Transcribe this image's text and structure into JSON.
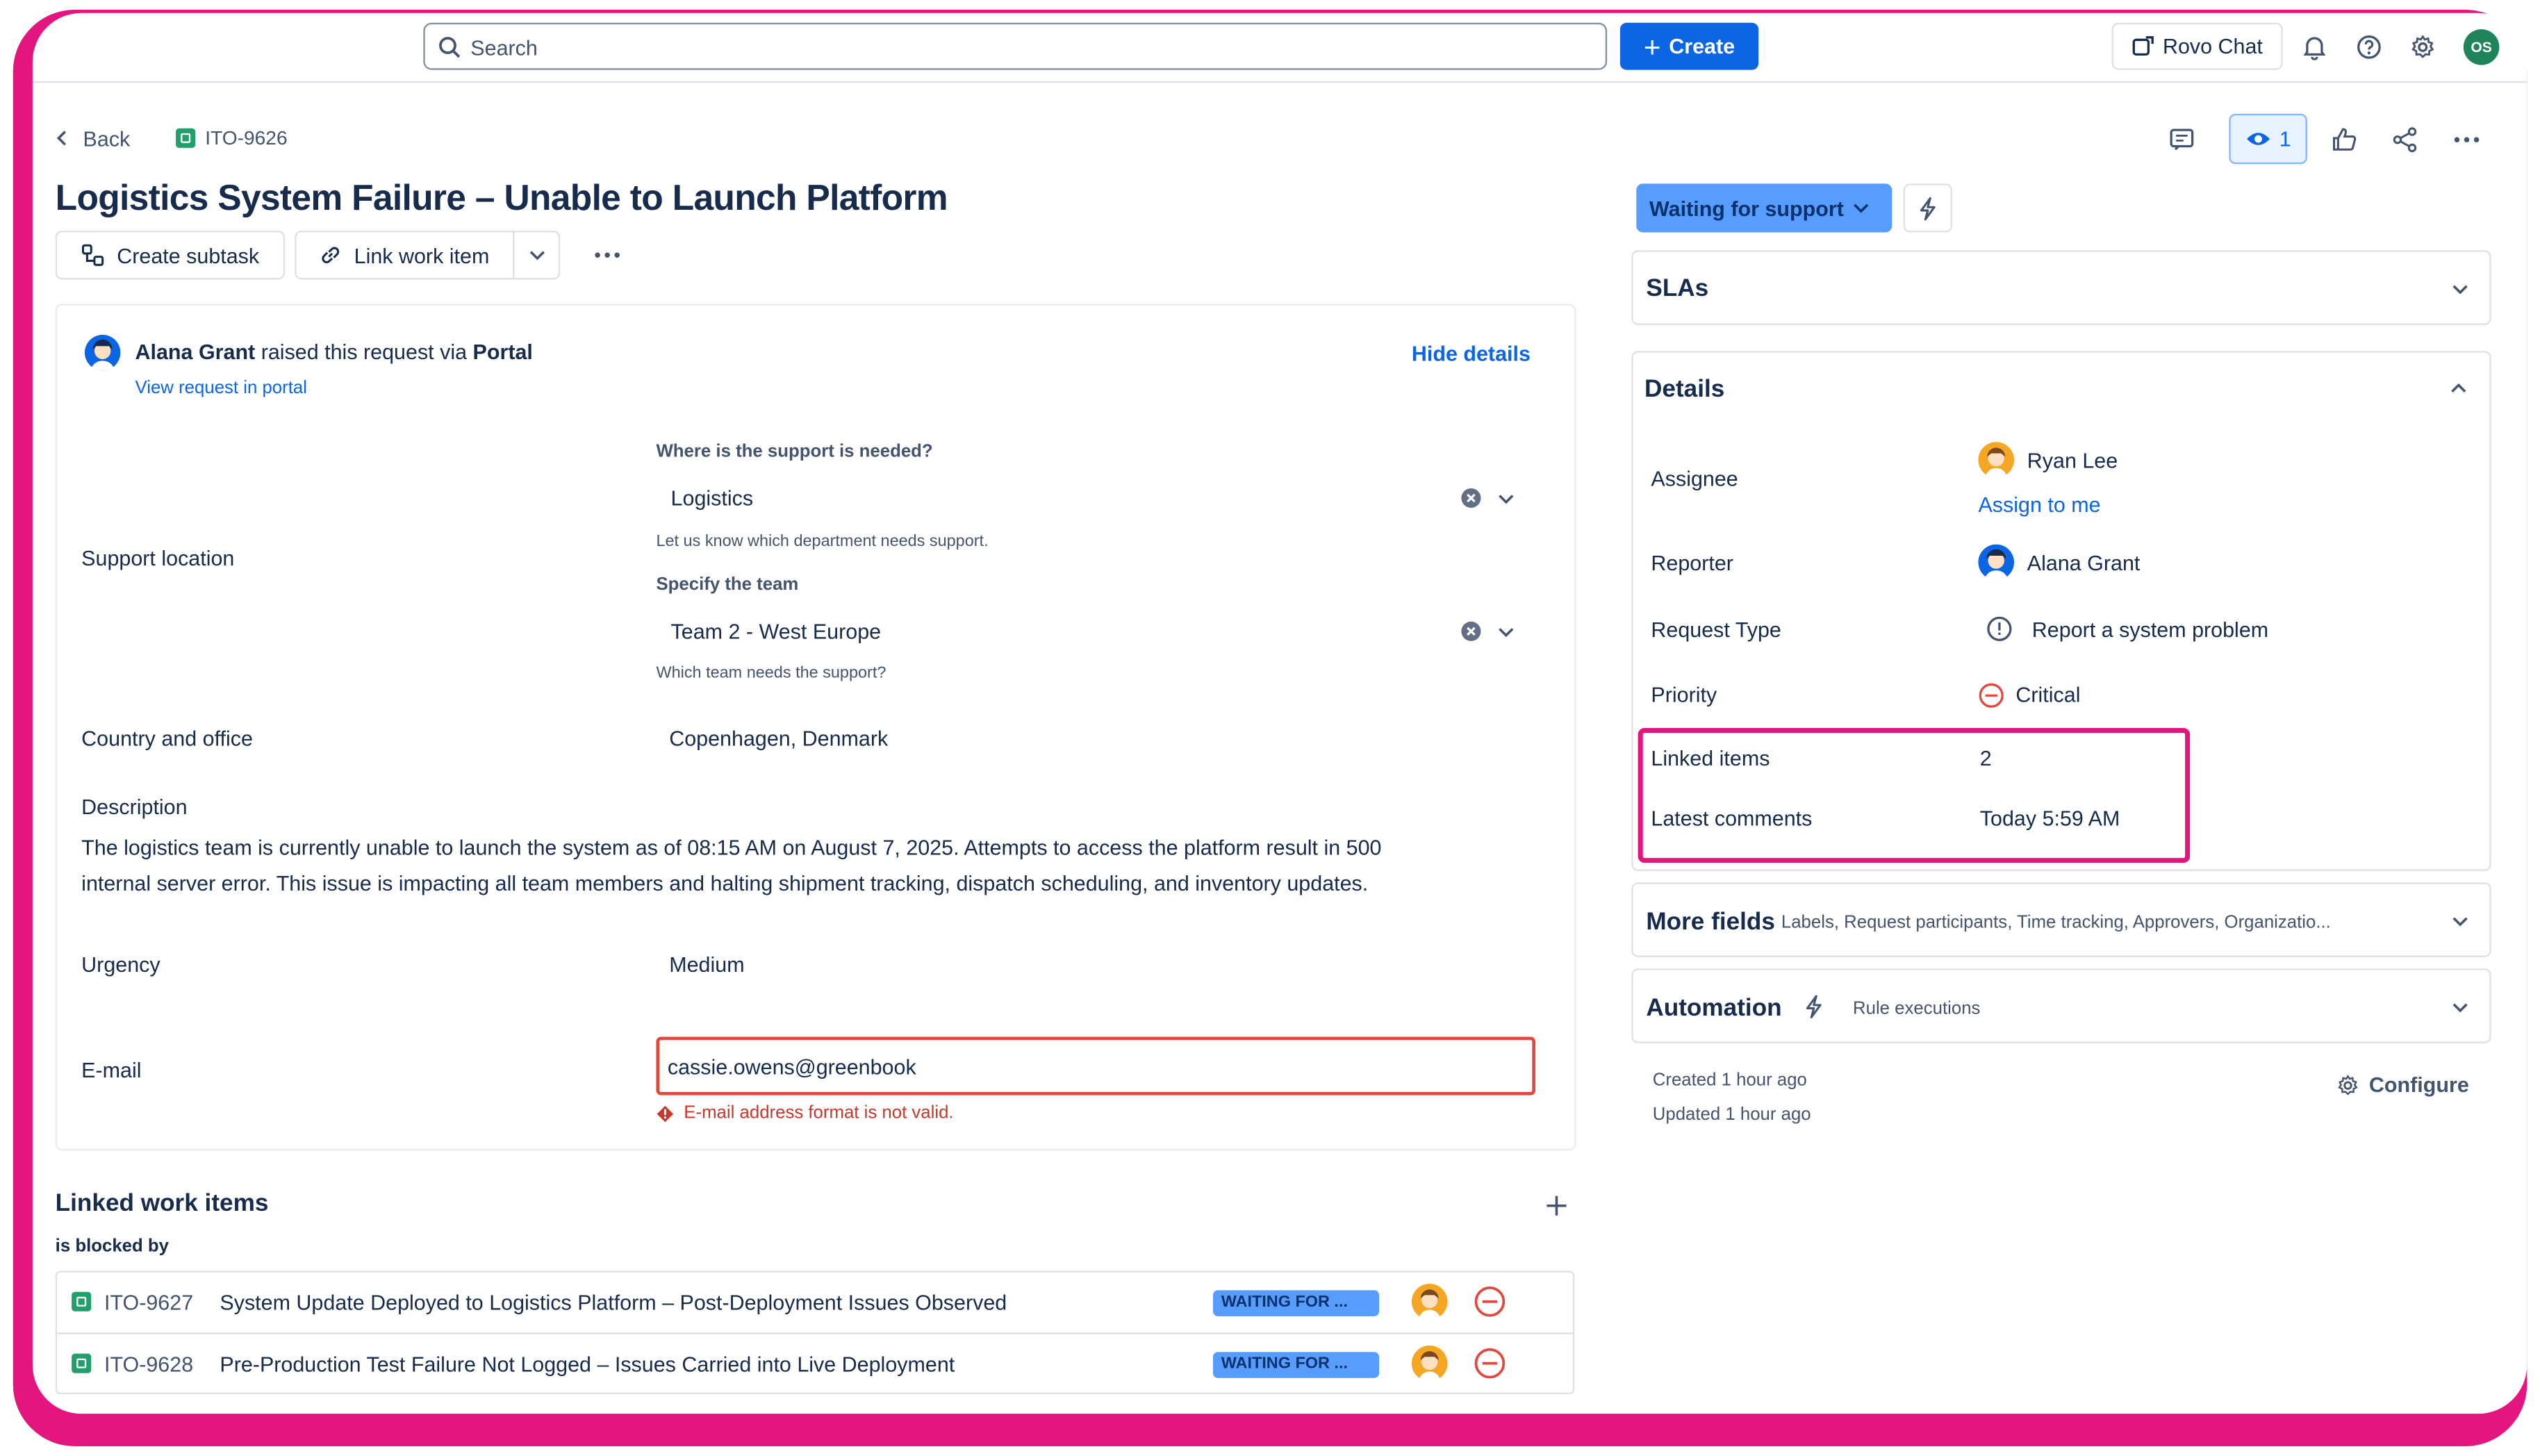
{
  "topbar": {
    "search_placeholder": "Search",
    "create_label": "Create",
    "rovo_label": "Rovo Chat",
    "avatar_initials": "OS"
  },
  "breadcrumb": {
    "back_label": "Back",
    "issue_key": "ITO-9626"
  },
  "issue": {
    "title": "Logistics System Failure – Unable to Launch Platform",
    "create_subtask": "Create subtask",
    "link_work_item": "Link work item",
    "watch_count": "1"
  },
  "request": {
    "reporter_name": "Alana Grant",
    "raised_text": "raised this request via",
    "channel": "Portal",
    "view_portal": "View request in portal",
    "hide_details": "Hide details",
    "support_location_label": "Support location",
    "where_needed_label": "Where is the support is needed?",
    "where_needed_value": "Logistics",
    "where_needed_help": "Let us know which department needs support.",
    "team_label": "Specify the team",
    "team_value": "Team 2 - West Europe",
    "team_help": "Which team needs the support?",
    "country_label": "Country and office",
    "country_value": "Copenhagen, Denmark",
    "description_label": "Description",
    "description_line1": "The logistics team is currently unable to launch the system as of 08:15 AM on August 7, 2025. Attempts to access the platform result in 500",
    "description_line2": "internal server error. This issue is impacting all team members and halting shipment tracking, dispatch scheduling, and inventory updates.",
    "urgency_label": "Urgency",
    "urgency_value": "Medium",
    "email_label": "E-mail",
    "email_value": "cassie.owens@greenbook",
    "email_error": "E-mail address format is not valid."
  },
  "linked": {
    "heading": "Linked work items",
    "relation": "is blocked by",
    "items": [
      {
        "key": "ITO-9627",
        "summary": "System Update Deployed to Logistics Platform – Post-Deployment Issues Observed",
        "status": "WAITING FOR ..."
      },
      {
        "key": "ITO-9628",
        "summary": "Pre-Production Test Failure Not Logged – Issues Carried into Live Deployment",
        "status": "WAITING FOR ..."
      }
    ]
  },
  "sidebar": {
    "status_label": "Waiting for support",
    "slas_label": "SLAs",
    "details_label": "Details",
    "assignee_label": "Assignee",
    "assignee_name": "Ryan Lee",
    "assign_to_me": "Assign to me",
    "reporter_label": "Reporter",
    "reporter_name": "Alana Grant",
    "request_type_label": "Request Type",
    "request_type_value": "Report a system problem",
    "priority_label": "Priority",
    "priority_value": "Critical",
    "linked_items_label": "Linked items",
    "linked_items_value": "2",
    "latest_comments_label": "Latest comments",
    "latest_comments_value": "Today 5:59 AM",
    "more_fields_label": "More fields",
    "more_fields_summary": "Labels, Request participants, Time tracking, Approvers, Organizatio...",
    "automation_label": "Automation",
    "rule_executions": "Rule executions",
    "created": "Created 1 hour ago",
    "updated": "Updated 1 hour ago",
    "configure": "Configure"
  },
  "colors": {
    "frame": "#e5157f",
    "primary": "#0c66e4",
    "status": "#579dff",
    "error": "#c9372c",
    "highlight": "#e5157f"
  }
}
